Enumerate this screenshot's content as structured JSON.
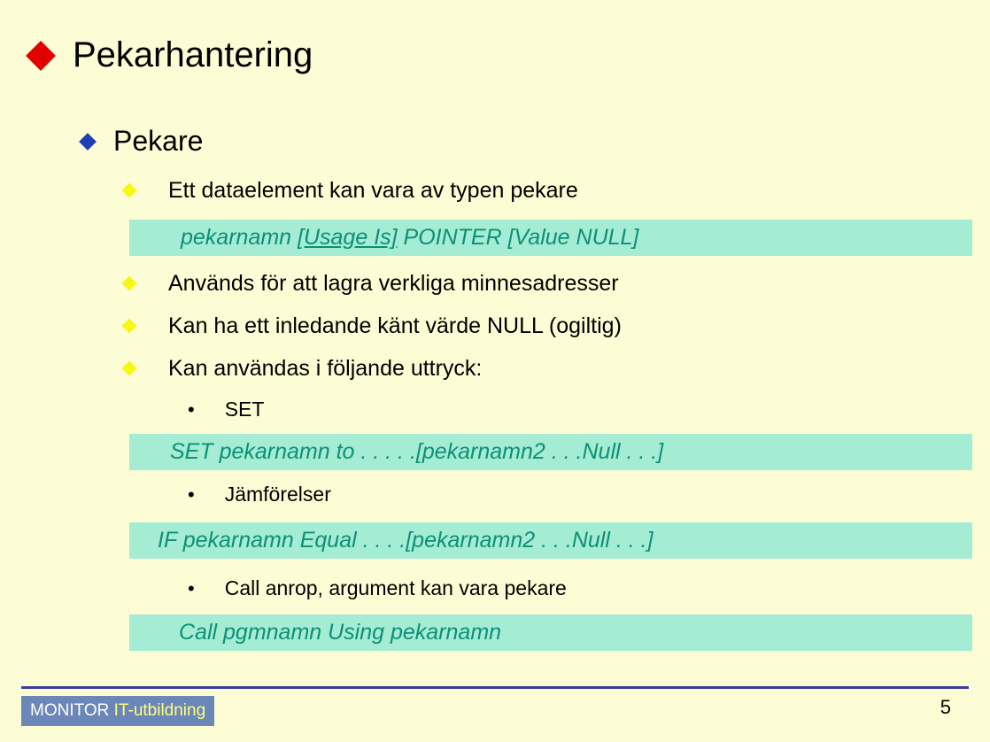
{
  "title": "Pekarhantering",
  "sub1": "Pekare",
  "bullets": {
    "b1": "Ett dataelement kan vara av typen pekare",
    "b2": "Används för att lagra verkliga minnesadresser",
    "b3": "Kan ha ett inledande känt värde NULL (ogiltig)",
    "b4": "Kan användas i följande uttryck:"
  },
  "code1_prefix": "pekarnamn ",
  "code1_underline": "[Usage Is]",
  "code1_suffix": " POINTER [Value NULL]",
  "sub_bullets": {
    "s1": "SET",
    "s2": "Jämförelser",
    "s3": "Call anrop, argument kan vara pekare"
  },
  "code2": "SET pekarnamn to . . . . .[pekarnamn2 . . .Null . . .]",
  "code3": "IF pekarnamn Equal . . . .[pekarnamn2 . . .Null . . .]",
  "code4": "Call pgmnamn Using pekarnamn",
  "footer": {
    "monitor": "MONITOR ",
    "it": "IT-utbildning"
  },
  "page": "5"
}
